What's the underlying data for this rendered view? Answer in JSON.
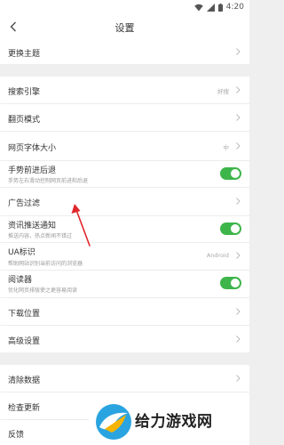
{
  "status_bar": {
    "time": "4:20",
    "icons": [
      "wifi-icon",
      "signal-icon",
      "battery-icon"
    ]
  },
  "header": {
    "title": "设置",
    "back_icon": "back-icon"
  },
  "sections": [
    {
      "items": [
        {
          "label": "更换主题",
          "type": "nav"
        }
      ]
    },
    {
      "items": [
        {
          "label": "搜索引擎",
          "type": "value",
          "value": "好搜"
        },
        {
          "label": "翻页模式",
          "type": "nav"
        },
        {
          "label": "网页字体大小",
          "type": "value",
          "value": "中"
        },
        {
          "label": "手势前进后退",
          "subtitle": "手势左右滑动控制网页前进和后退",
          "type": "toggle",
          "on": true
        },
        {
          "label": "广告过滤",
          "type": "nav"
        },
        {
          "label": "资讯推送通知",
          "subtitle": "推送内容，热点新闻不错过",
          "type": "toggle",
          "on": true
        },
        {
          "label": "UA标识",
          "subtitle": "帮助网站识别当前访问的浏览器",
          "type": "value",
          "value": "Android"
        },
        {
          "label": "阅读器",
          "subtitle": "优化网页排版使之更容易阅读",
          "type": "toggle",
          "on": true
        },
        {
          "label": "下载位置",
          "type": "nav"
        },
        {
          "label": "高级设置",
          "type": "nav"
        }
      ]
    },
    {
      "items": [
        {
          "label": "清除数据",
          "type": "nav"
        },
        {
          "label": "检查更新",
          "type": "nav"
        },
        {
          "label": "反馈",
          "type": "nav"
        }
      ]
    }
  ],
  "annotation": {
    "arrow_color": "#e0262b"
  },
  "watermark": {
    "text": "给力游戏网"
  },
  "colors": {
    "toggle_on": "#3db54a",
    "background": "#efeff0",
    "row": "#ffffff"
  }
}
